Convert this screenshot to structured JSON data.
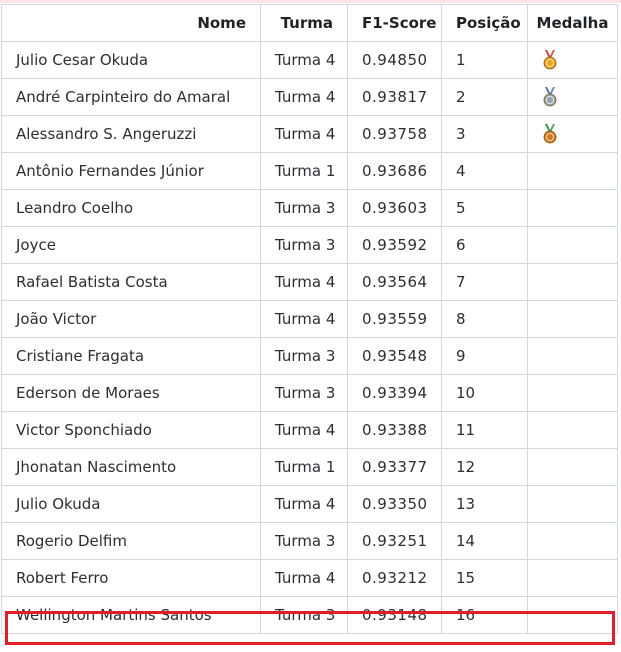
{
  "columns": {
    "name": "Nome",
    "turma": "Turma",
    "score": "F1-Score",
    "position": "Posição",
    "medal": "Medalha"
  },
  "colors": {
    "highlight": "#e01e2a",
    "gold": "#e8a317",
    "silver": "#9aa4ad",
    "bronze": "#d2771f",
    "ribbon_gold": "#c0392b",
    "ribbon_silver": "#4a6fa5",
    "ribbon_bronze": "#2e8b3a"
  },
  "rows": [
    {
      "name": "Julio Cesar Okuda",
      "turma": "Turma 4",
      "score": "0.94850",
      "position": "1",
      "medal": "gold-medal-icon"
    },
    {
      "name": "André Carpinteiro do Amaral",
      "turma": "Turma 4",
      "score": "0.93817",
      "position": "2",
      "medal": "silver-medal-icon"
    },
    {
      "name": "Alessandro S. Angeruzzi",
      "turma": "Turma 4",
      "score": "0.93758",
      "position": "3",
      "medal": "bronze-medal-icon"
    },
    {
      "name": "Antônio Fernandes Júnior",
      "turma": "Turma 1",
      "score": "0.93686",
      "position": "4",
      "medal": ""
    },
    {
      "name": "Leandro Coelho",
      "turma": "Turma 3",
      "score": "0.93603",
      "position": "5",
      "medal": ""
    },
    {
      "name": "Joyce",
      "turma": "Turma 3",
      "score": "0.93592",
      "position": "6",
      "medal": ""
    },
    {
      "name": "Rafael Batista Costa",
      "turma": "Turma 4",
      "score": "0.93564",
      "position": "7",
      "medal": ""
    },
    {
      "name": "João Victor",
      "turma": "Turma 4",
      "score": "0.93559",
      "position": "8",
      "medal": ""
    },
    {
      "name": "Cristiane Fragata",
      "turma": "Turma 3",
      "score": "0.93548",
      "position": "9",
      "medal": ""
    },
    {
      "name": "Ederson de Moraes",
      "turma": "Turma 3",
      "score": "0.93394",
      "position": "10",
      "medal": ""
    },
    {
      "name": "Victor Sponchiado",
      "turma": "Turma 4",
      "score": "0.93388",
      "position": "11",
      "medal": ""
    },
    {
      "name": "Jhonatan Nascimento",
      "turma": "Turma 1",
      "score": "0.93377",
      "position": "12",
      "medal": ""
    },
    {
      "name": "Julio Okuda",
      "turma": "Turma 4",
      "score": "0.93350",
      "position": "13",
      "medal": ""
    },
    {
      "name": "Rogerio Delfim",
      "turma": "Turma 3",
      "score": "0.93251",
      "position": "14",
      "medal": ""
    },
    {
      "name": "Robert Ferro",
      "turma": "Turma 4",
      "score": "0.93212",
      "position": "15",
      "medal": ""
    },
    {
      "name": "Wellington Martins Santos",
      "turma": "Turma 3",
      "score": "0.93148",
      "position": "16",
      "medal": ""
    }
  ],
  "highlighted_row": "16"
}
